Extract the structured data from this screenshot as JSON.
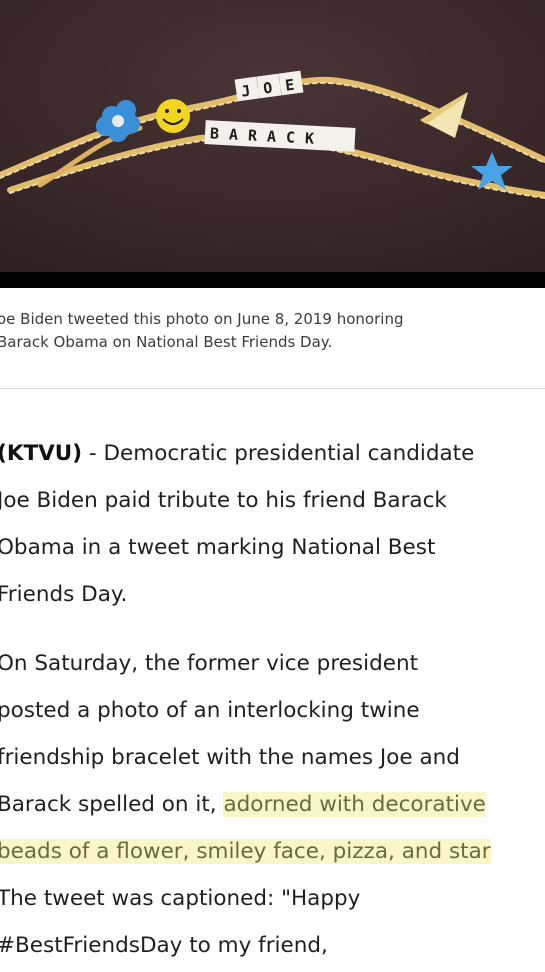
{
  "photo": {
    "beads_top": [
      "J",
      "O",
      "E"
    ],
    "beads_bottom": [
      "B",
      "A",
      "R",
      "A",
      "C",
      "K"
    ],
    "icons": [
      "flower-bead-icon",
      "smiley-bead-icon",
      "pizza-bead-icon",
      "star-bead-icon"
    ],
    "background_color": "#3a2a2b"
  },
  "caption": {
    "line1": "oe Biden tweeted this photo on June 8, 2019 honoring",
    "line2": "Barack Obama on National Best Friends Day."
  },
  "article": {
    "p1": {
      "source": "(KTVU)",
      "line1_rest": " - Democratic presidential candidate",
      "line2": "Joe Biden paid tribute to his friend Barack",
      "line3": "Obama in a tweet marking National Best",
      "line4": "Friends Day."
    },
    "p2": {
      "line1": "On Saturday, the former vice president",
      "line2": "posted a photo of an interlocking twine",
      "line3": "friendship bracelet with the names Joe and",
      "line4_plain": "Barack spelled on it, ",
      "line4_highlight": "adorned with decorative",
      "line5_highlight": "beads of a flower, smiley face, pizza, and star",
      "line6": "The tweet was captioned:  \"Happy",
      "line7": "#BestFriendsDay to my friend,"
    }
  }
}
